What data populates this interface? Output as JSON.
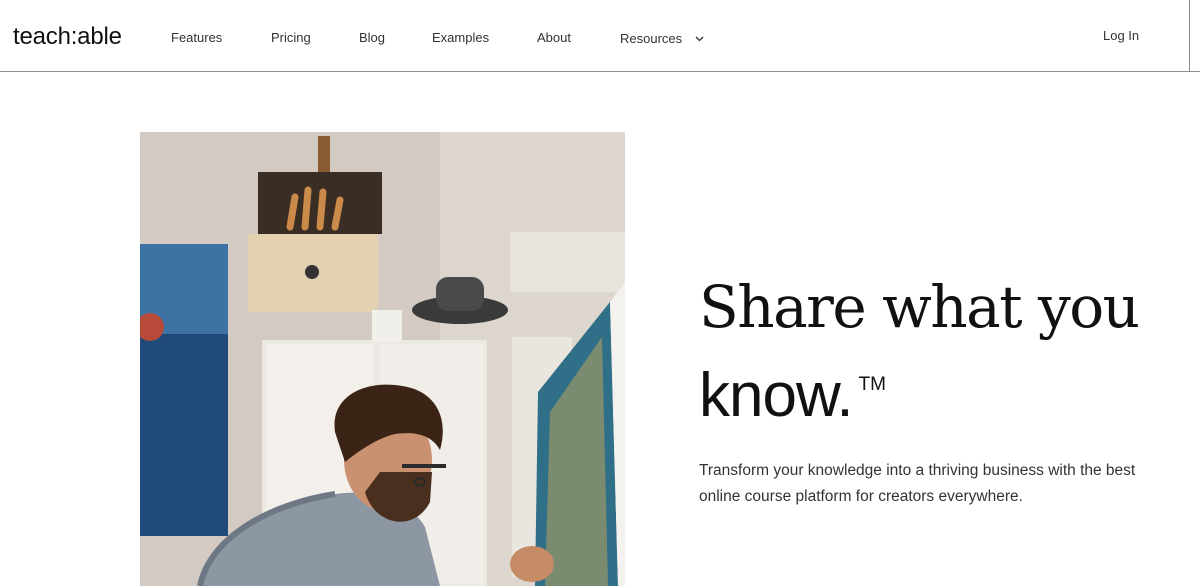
{
  "header": {
    "logo": "teach:able",
    "nav": {
      "features": "Features",
      "pricing": "Pricing",
      "blog": "Blog",
      "examples": "Examples",
      "about": "About",
      "resources": "Resources"
    },
    "login": "Log In"
  },
  "hero": {
    "headline_line1": "Share what you",
    "headline_line2": "know.",
    "trademark": "TM",
    "subtext": "Transform your knowledge into a thriving business with the best online course platform for creators everywhere."
  },
  "icons": {
    "resources_dropdown": "chevron-down-icon"
  },
  "colors": {
    "text": "#111111",
    "header_border": "#8c8c8c",
    "background": "#ffffff"
  }
}
